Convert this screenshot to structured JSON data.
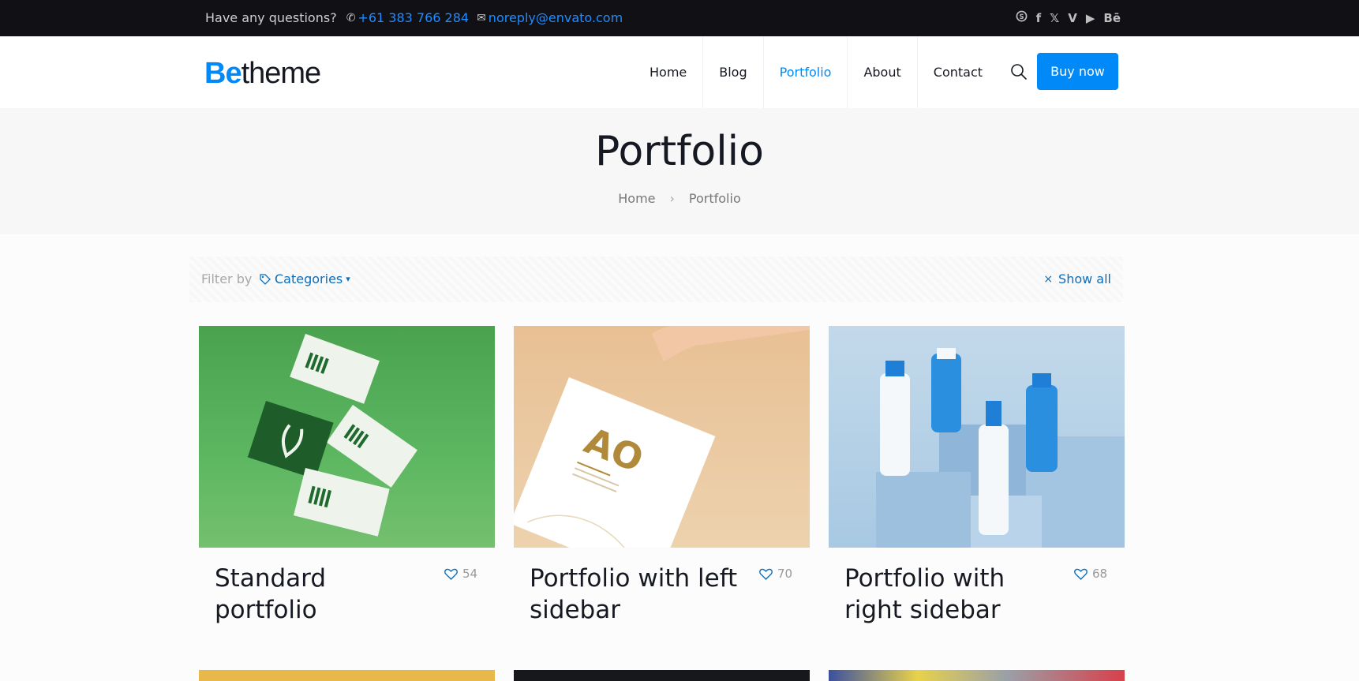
{
  "topbar": {
    "question": "Have any questions?",
    "phone": "+61 383 766 284",
    "email": "noreply@envato.com",
    "social_icons": [
      "skype-icon",
      "facebook-icon",
      "x-twitter-icon",
      "vimeo-icon",
      "youtube-icon",
      "behance-icon"
    ],
    "behance_label": "Bē"
  },
  "header": {
    "logo_be": "Be",
    "logo_theme": "theme",
    "nav": [
      "Home",
      "Blog",
      "Portfolio",
      "About",
      "Contact"
    ],
    "active_nav": "Portfolio",
    "buy_label": "Buy now"
  },
  "subheader": {
    "title": "Portfolio",
    "breadcrumb": [
      "Home",
      "Portfolio"
    ]
  },
  "filter": {
    "label": "Filter by",
    "categories": "Categories",
    "show_all": "Show all"
  },
  "portfolio": [
    {
      "title": "Standard portfolio",
      "likes": "54"
    },
    {
      "title": "Portfolio with left sidebar",
      "likes": "70"
    },
    {
      "title": "Portfolio with right sidebar",
      "likes": "68"
    }
  ],
  "colors": {
    "accent": "#0089f7",
    "topbar_bg": "#101015",
    "subheader_bg": "#f7f7f7",
    "link": "#0a6ebd"
  }
}
